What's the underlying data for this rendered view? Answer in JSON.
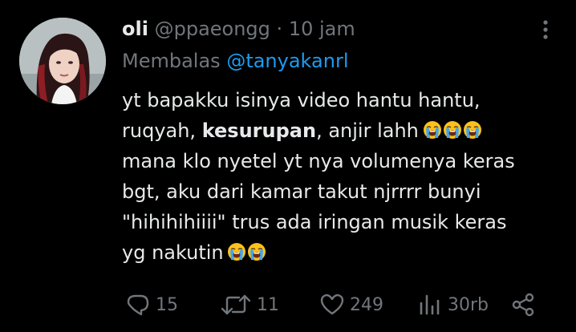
{
  "tweet": {
    "display_name": "oli",
    "handle": "@ppaeongg",
    "separator": "·",
    "time": "10 jam",
    "replying_prefix": "Membalas",
    "replying_to": "@tanyakanrl",
    "lines": [
      "yt bapakku isinya video hantu hantu,",
      "ruqyah, ",
      "kesurupan",
      ", anjir lahh",
      "mana klo nyetel yt nya volumenya keras",
      "bgt, aku dari kamar takut njrrrr bunyi",
      "\"hihihihiiii\" trus ada iringan musik keras",
      "yg nakutin"
    ],
    "emoji_name": "loudly-crying-face"
  },
  "actions": {
    "reply_count": "15",
    "retweet_count": "11",
    "like_count": "249",
    "views_count": "30rb",
    "icons": [
      "reply-icon",
      "retweet-icon",
      "like-icon",
      "views-icon",
      "share-icon"
    ]
  },
  "colors": {
    "background": "#000000",
    "text": "#e7e9ea",
    "muted": "#71767b",
    "link": "#1d9bf0"
  }
}
